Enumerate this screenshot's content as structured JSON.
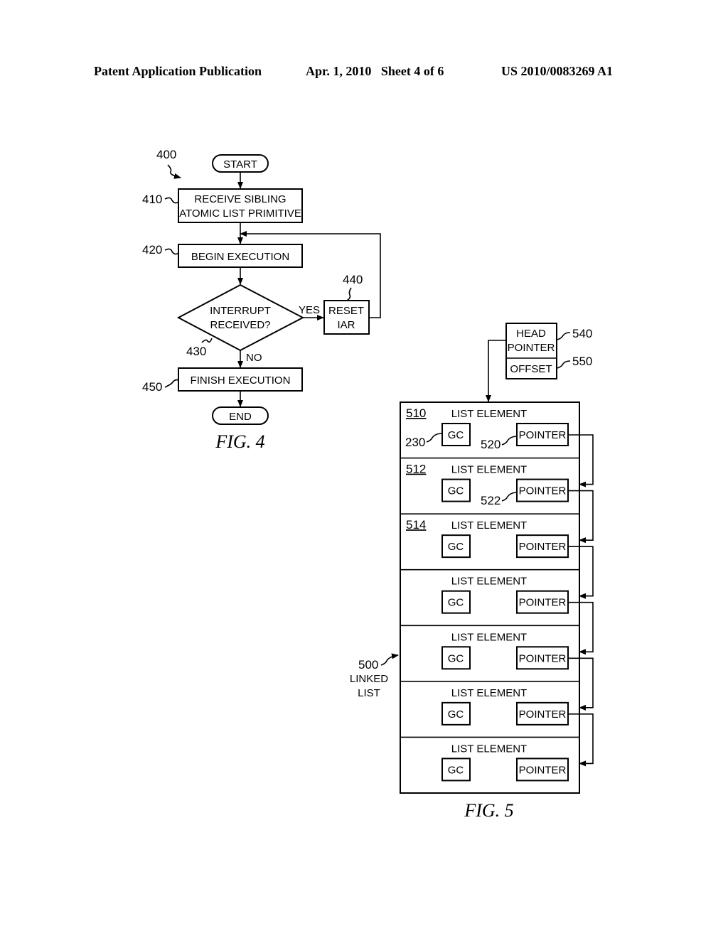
{
  "header": {
    "publication": "Patent Application Publication",
    "date_sheet": "Apr. 1, 2010   Sheet 4 of 6",
    "number": "US 2010/0083269 A1"
  },
  "fig4": {
    "caption": "FIG. 4",
    "ref_main": "400",
    "start": "START",
    "end": "END",
    "step410": {
      "ref": "410",
      "line1": "RECEIVE SIBLING",
      "line2": "ATOMIC LIST PRIMITIVE"
    },
    "step420": {
      "ref": "420",
      "label": "BEGIN EXECUTION"
    },
    "step430": {
      "ref": "430",
      "line1": "INTERRUPT",
      "line2": "RECEIVED?",
      "yes": "YES",
      "no": "NO"
    },
    "step440": {
      "ref": "440",
      "line1": "RESET",
      "line2": "IAR"
    },
    "step450": {
      "ref": "450",
      "label": "FINISH EXECUTION"
    }
  },
  "fig5": {
    "caption": "FIG. 5",
    "head": {
      "line1": "HEAD",
      "line2": "POINTER",
      "ref": "540"
    },
    "offset": {
      "label": "OFFSET",
      "ref": "550"
    },
    "linked_list": {
      "ref": "500",
      "line1": "LINKED",
      "line2": "LIST"
    },
    "gc_ref": "230",
    "pointer_ref_first": "520",
    "pointer_ref_second": "522",
    "elements": [
      {
        "ref": "510",
        "title": "LIST ELEMENT",
        "gc": "GC",
        "pointer": "POINTER"
      },
      {
        "ref": "512",
        "title": "LIST ELEMENT",
        "gc": "GC",
        "pointer": "POINTER"
      },
      {
        "ref": "514",
        "title": "LIST ELEMENT",
        "gc": "GC",
        "pointer": "POINTER"
      },
      {
        "ref": "",
        "title": "LIST ELEMENT",
        "gc": "GC",
        "pointer": "POINTER"
      },
      {
        "ref": "",
        "title": "LIST ELEMENT",
        "gc": "GC",
        "pointer": "POINTER"
      },
      {
        "ref": "",
        "title": "LIST ELEMENT",
        "gc": "GC",
        "pointer": "POINTER"
      },
      {
        "ref": "",
        "title": "LIST ELEMENT",
        "gc": "GC",
        "pointer": "POINTER"
      }
    ]
  }
}
